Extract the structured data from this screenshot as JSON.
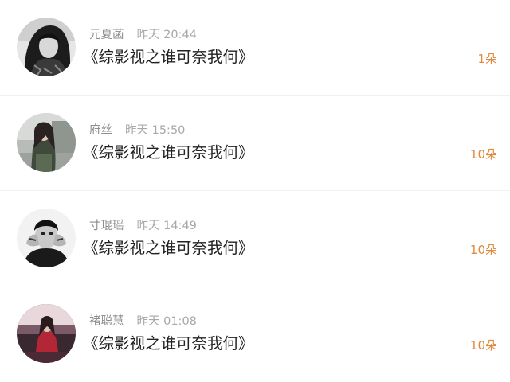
{
  "items": [
    {
      "name": "元夏菡",
      "time": "昨天 20:44",
      "title": "《综影视之谁可奈我何》",
      "count": "1朵",
      "avatar": "woman-portrait-bw"
    },
    {
      "name": "府丝",
      "time": "昨天 15:50",
      "title": "《综影视之谁可奈我何》",
      "count": "10朵",
      "avatar": "girl-street-photo"
    },
    {
      "name": "寸琨瑶",
      "time": "昨天 14:49",
      "title": "《综影视之谁可奈我何》",
      "count": "10朵",
      "avatar": "man-hands-face-bw"
    },
    {
      "name": "褚聪慧",
      "time": "昨天 01:08",
      "title": "《综影视之谁可奈我何》",
      "count": "10朵",
      "avatar": "girl-red-dress-photo"
    }
  ],
  "colors": {
    "count": "#e08a3e",
    "meta": "#9b9b9b",
    "title": "#222222",
    "divider": "#f1f1f1"
  }
}
